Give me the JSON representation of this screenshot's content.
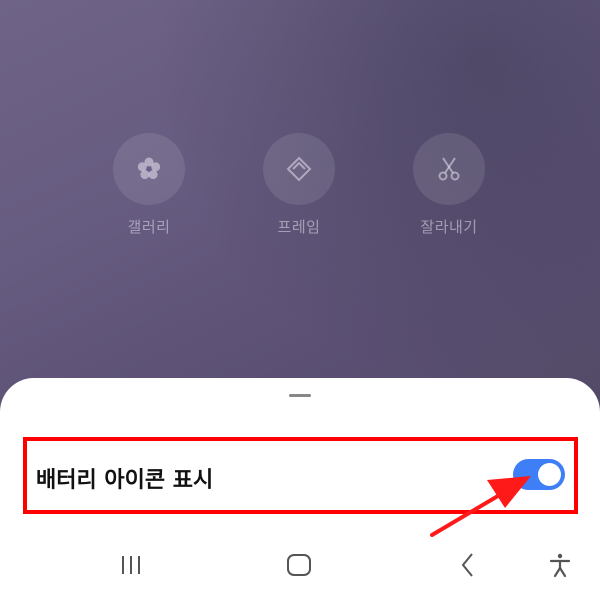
{
  "actions": [
    {
      "id": "gallery",
      "label": "갤러리",
      "icon": "flower-icon"
    },
    {
      "id": "frame",
      "label": "프레임",
      "icon": "frame-icon"
    },
    {
      "id": "cut",
      "label": "잘라내기",
      "icon": "scissors-icon"
    }
  ],
  "sheet": {
    "setting_label": "배터리 아이콘 표시",
    "toggle_on": true
  },
  "colors": {
    "toggle_accent": "#3e7ef7",
    "highlight": "#ff0000"
  },
  "navbar": {
    "buttons": [
      "recents-icon",
      "home-icon",
      "back-icon",
      "accessibility-icon"
    ]
  }
}
